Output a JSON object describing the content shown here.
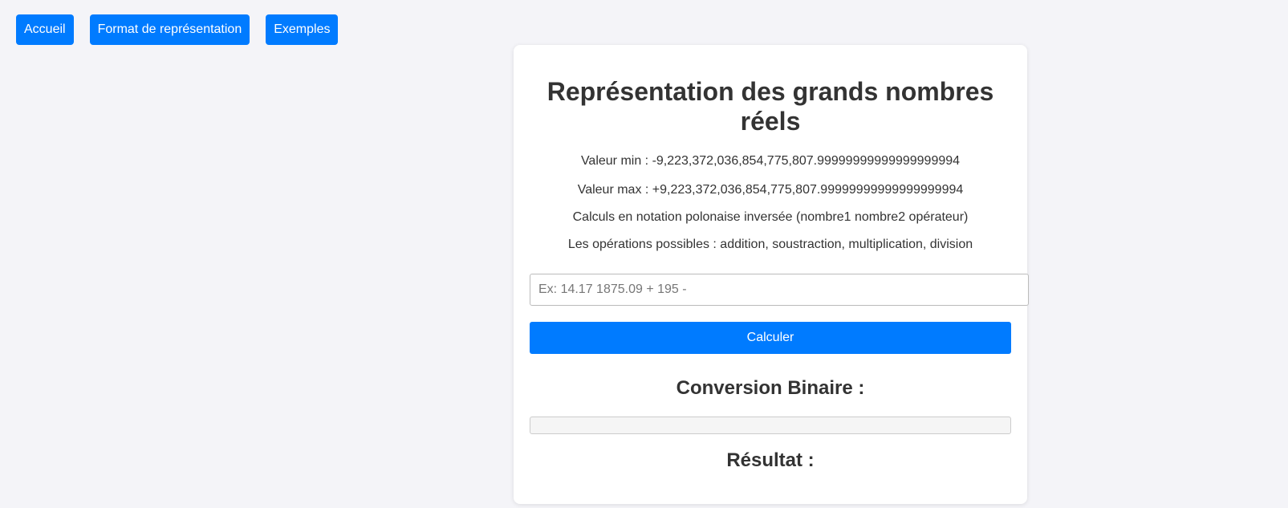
{
  "nav": {
    "items": [
      {
        "label": "Accueil"
      },
      {
        "label": "Format de représentation"
      },
      {
        "label": "Exemples"
      }
    ]
  },
  "card": {
    "title": "Représentation des grands nombres réels",
    "min_value": "Valeur min : -9,223,372,036,854,775,807.99999999999999999994",
    "max_value": "Valeur max : +9,223,372,036,854,775,807.99999999999999999994",
    "rpn_note": "Calculs en notation polonaise inversée (nombre1 nombre2 opérateur)",
    "operations": "Les opérations possibles : addition, soustraction, multiplication, division",
    "input": {
      "value": "",
      "placeholder": "Ex: 14.17 1875.09 + 195 -"
    },
    "calculate_label": "Calculer",
    "binary_heading": "Conversion Binaire :",
    "binary_value": "",
    "result_heading": "Résultat :"
  },
  "colors": {
    "accent": "#007bff",
    "background": "#f4f4f8",
    "card": "#ffffff",
    "text": "#333333"
  }
}
